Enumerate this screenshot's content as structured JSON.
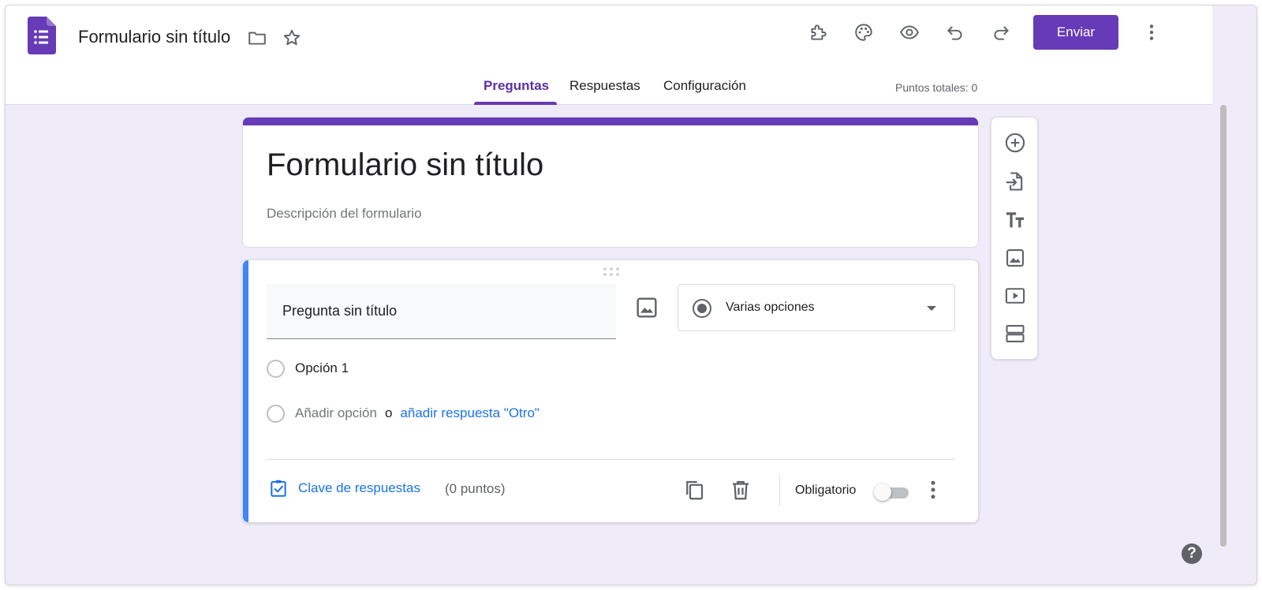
{
  "header": {
    "doc_title": "Formulario sin título",
    "send_label": "Enviar",
    "icons": [
      "forms-logo-icon",
      "folder-icon",
      "star-icon",
      "addon-puzzle-icon",
      "palette-icon",
      "preview-eye-icon",
      "undo-icon",
      "redo-icon",
      "more-vert-icon"
    ],
    "tabs": [
      {
        "label": "Preguntas",
        "active": true
      },
      {
        "label": "Respuestas",
        "active": false
      },
      {
        "label": "Configuración",
        "active": false
      }
    ],
    "points_total": "Puntos totales: 0"
  },
  "title_card": {
    "title": "Formulario sin título",
    "description_placeholder": "Descripción del formulario"
  },
  "question": {
    "text": "Pregunta sin título",
    "type": "Varias opciones",
    "options": [
      {
        "label": "Opción 1"
      }
    ],
    "add_option": "Añadir opción",
    "or": "o",
    "add_other": "añadir respuesta \"Otro\"",
    "answer_key": "Clave de respuestas",
    "points": "(0 puntos)",
    "required_label": "Obligatorio",
    "required": false
  },
  "side_toolbar": {
    "tools": [
      "add-question-icon",
      "import-questions-icon",
      "add-title-icon",
      "add-image-icon",
      "add-video-icon",
      "add-section-icon"
    ]
  },
  "help": {
    "label": "?"
  },
  "colors": {
    "brand": "#673ab7",
    "background": "#f0ebf8",
    "focus_bar": "#4285f4",
    "link": "#1a73e8"
  }
}
